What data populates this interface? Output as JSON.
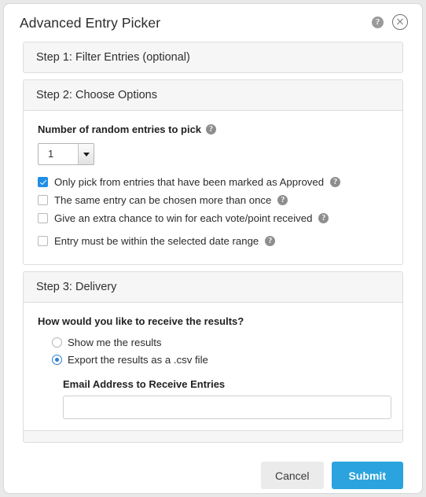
{
  "dialog": {
    "title": "Advanced Entry Picker",
    "help_icon": "help-icon",
    "help_glyph": "?",
    "close_icon": "close-icon",
    "accent_blue": "#2ba3de",
    "checkbox_blue": "#1e8fe8",
    "radio_blue": "#2a7fd4"
  },
  "steps": {
    "step1": {
      "heading": "Step 1: Filter Entries (optional)"
    },
    "step2": {
      "heading": "Step 2: Choose Options",
      "count_label": "Number of random entries to pick",
      "count_value": "1",
      "checkboxes": [
        {
          "label": "Only pick from entries that have been marked as Approved",
          "checked": true
        },
        {
          "label": "The same entry can be chosen more than once",
          "checked": false
        },
        {
          "label": "Give an extra chance to win for each vote/point received",
          "checked": false
        },
        {
          "label": "Entry must be within the selected date range",
          "checked": false
        }
      ]
    },
    "step3": {
      "heading": "Step 3: Delivery",
      "question": "How would you like to receive the results?",
      "options": [
        {
          "label": "Show me the results",
          "selected": false
        },
        {
          "label": "Export the results as a .csv file",
          "selected": true
        }
      ],
      "email_label": "Email Address to Receive Entries",
      "email_value": "",
      "email_placeholder": ""
    }
  },
  "footer": {
    "cancel_label": "Cancel",
    "submit_label": "Submit"
  }
}
